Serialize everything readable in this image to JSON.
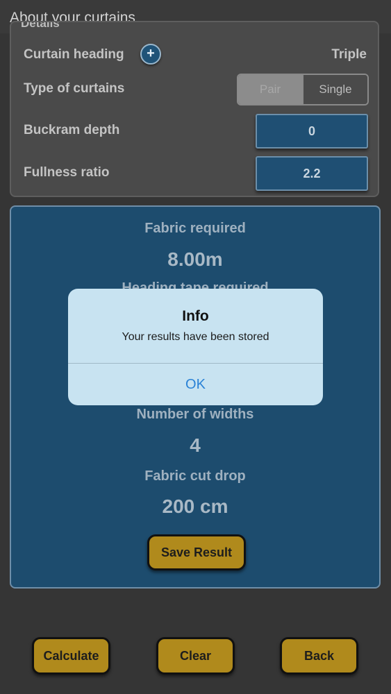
{
  "header": {
    "title": "About your curtains"
  },
  "details": {
    "section_peek": "Details",
    "curtain_heading": {
      "label": "Curtain heading",
      "value": "Triple",
      "add_icon": "plus-icon"
    },
    "type_of_curtains": {
      "label": "Type of curtains",
      "options": [
        "Pair",
        "Single"
      ]
    },
    "buckram_depth": {
      "label": "Buckram depth",
      "value": "0"
    },
    "fullness_ratio": {
      "label": "Fullness ratio",
      "value": "2.2"
    }
  },
  "results": {
    "fabric_required": {
      "label": "Fabric required",
      "value": "8.00m"
    },
    "heading_tape_required": {
      "label": "Heading tape required"
    },
    "number_of_widths": {
      "label": "Number of widths",
      "value": "4"
    },
    "fabric_cut_drop": {
      "label": "Fabric cut drop",
      "value": "200 cm"
    },
    "save_button": "Save Result"
  },
  "dialog": {
    "title": "Info",
    "message": "Your results have been stored",
    "ok": "OK"
  },
  "footer": {
    "calculate": "Calculate",
    "clear": "Clear",
    "back": "Back"
  },
  "colors": {
    "accent_gold": "#b08a1c",
    "panel_blue": "#1d4c6e",
    "dialog_bg": "#c8e3f1",
    "link_blue": "#2a82d6"
  }
}
